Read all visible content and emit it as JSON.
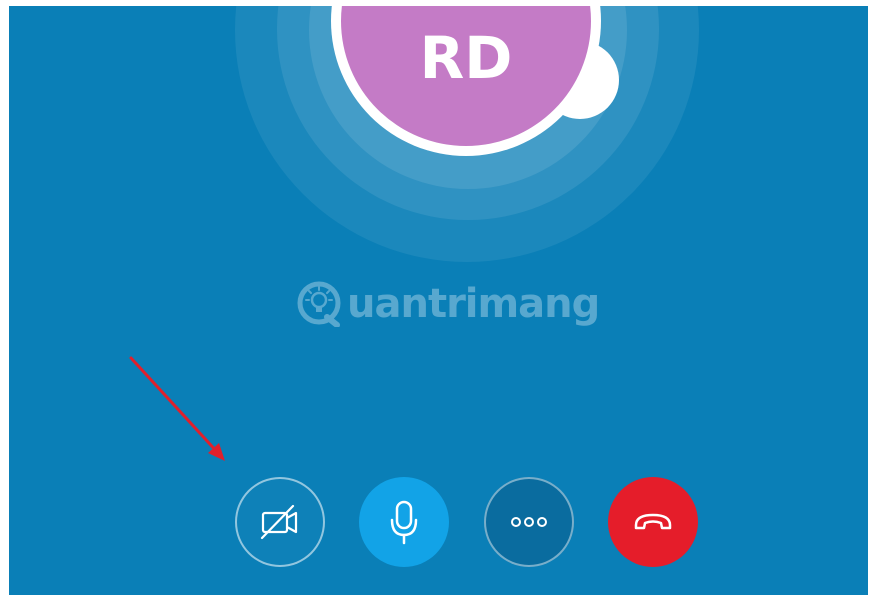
{
  "call": {
    "avatar_initials": "RD",
    "avatar_color": "#c47bc6",
    "background_color": "#0a7fb7"
  },
  "watermark": {
    "text": "uantrimang"
  },
  "controls": {
    "video_toggle": {
      "icon": "video-off-icon",
      "state": "off"
    },
    "microphone": {
      "icon": "microphone-icon",
      "state": "on",
      "color": "#12a3e7"
    },
    "more": {
      "icon": "more-dots-icon"
    },
    "end_call": {
      "icon": "hang-up-icon",
      "color": "#e51d2a"
    }
  },
  "annotation": {
    "arrow_color": "#e0202c",
    "points_to": "video-toggle-button"
  }
}
